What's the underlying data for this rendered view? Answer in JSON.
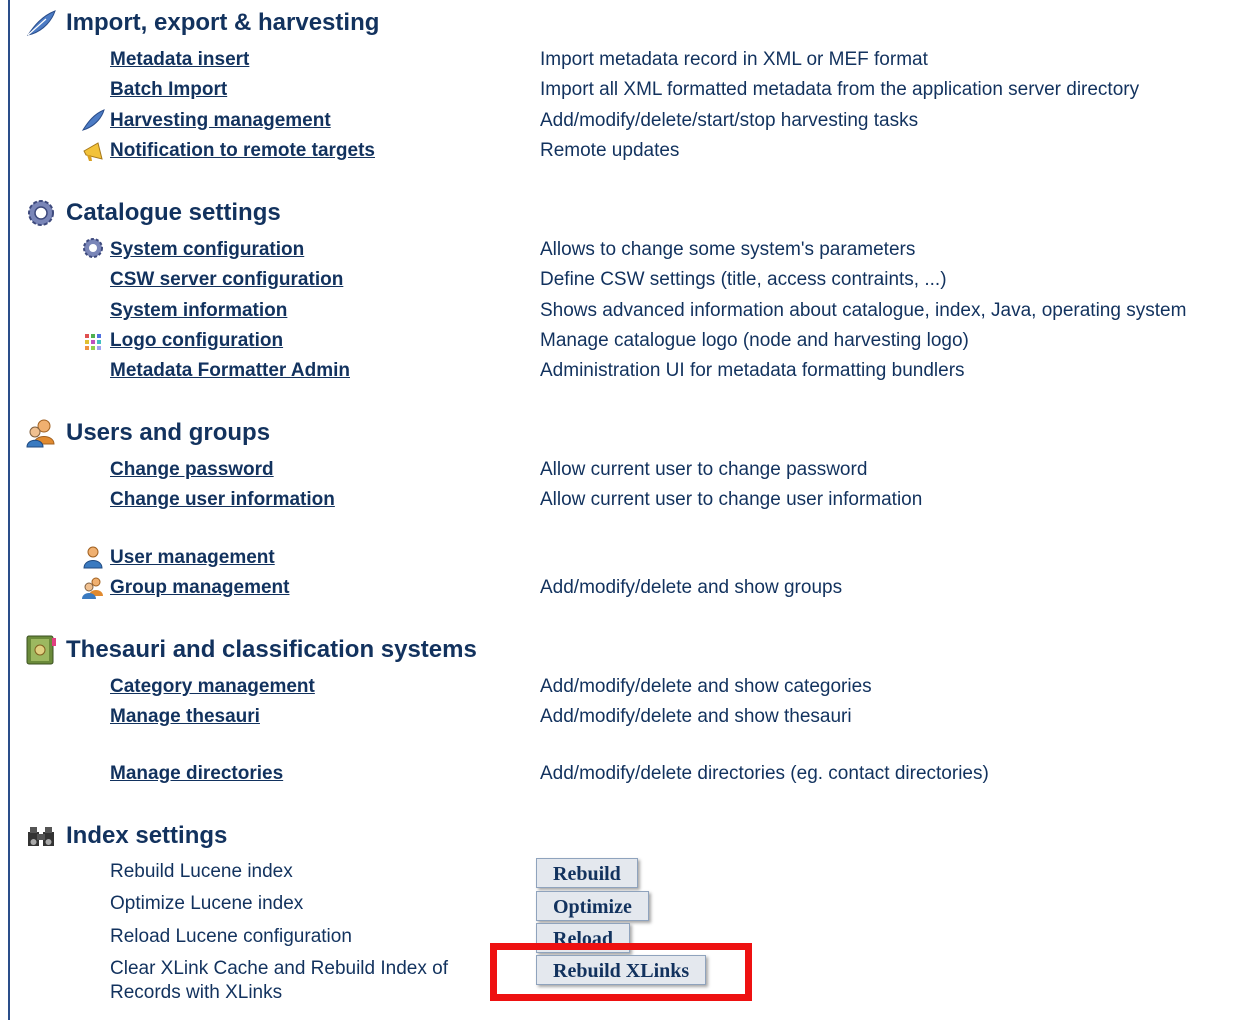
{
  "sections": {
    "import": {
      "title": "Import, export & harvesting",
      "icon": "feather-icon",
      "items": [
        {
          "label": "Metadata insert",
          "desc": "Import metadata record in XML or MEF format"
        },
        {
          "label": "Batch Import",
          "desc": "Import all XML formatted metadata from the application server directory"
        },
        {
          "label": "Harvesting management",
          "desc": "Add/modify/delete/start/stop harvesting tasks",
          "icon": "feather-icon"
        },
        {
          "label": "Notification to remote targets",
          "desc": "Remote updates",
          "icon": "megaphone-icon"
        }
      ]
    },
    "catalogue": {
      "title": "Catalogue settings",
      "icon": "gear-icon",
      "items": [
        {
          "label": "System configuration",
          "desc": "Allows to change some system's parameters",
          "icon": "gear-icon"
        },
        {
          "label": "CSW server configuration",
          "desc": "Define CSW settings (title, access contraints, ...)"
        },
        {
          "label": "System information",
          "desc": "Shows advanced information about catalogue, index, Java, operating system"
        },
        {
          "label": "Logo configuration",
          "desc": "Manage catalogue logo (node and harvesting logo)",
          "icon": "color-grid-icon"
        },
        {
          "label": "Metadata Formatter Admin",
          "desc": "Administration UI for metadata formatting bundlers"
        }
      ]
    },
    "users": {
      "title": "Users and groups",
      "icon": "users-icon",
      "items": [
        {
          "label": "Change password",
          "desc": "Allow current user to change password"
        },
        {
          "label": "Change user information",
          "desc": "Allow current user to change user information"
        },
        {
          "label": "User management",
          "desc": "",
          "icon": "user-icon"
        },
        {
          "label": "Group management",
          "desc": "Add/modify/delete and show groups",
          "icon": "group-icon"
        }
      ]
    },
    "thesauri": {
      "title": "Thesauri and classification systems",
      "icon": "book-icon",
      "items": [
        {
          "label": "Category management",
          "desc": "Add/modify/delete and show categories"
        },
        {
          "label": "Manage thesauri",
          "desc": "Add/modify/delete and show thesauri"
        },
        {
          "label": "Manage directories",
          "desc": "Add/modify/delete directories (eg. contact directories)"
        }
      ]
    },
    "index": {
      "title": "Index settings",
      "icon": "binoculars-icon",
      "items": [
        {
          "label": "Rebuild Lucene index",
          "button": "Rebuild"
        },
        {
          "label": "Optimize Lucene index",
          "button": "Optimize"
        },
        {
          "label": "Reload Lucene configuration",
          "button": "Reload"
        },
        {
          "label_line1": "Clear XLink Cache and Rebuild Index of",
          "label_line2": "Records with XLinks",
          "button": "Rebuild XLinks"
        }
      ]
    }
  },
  "colors": {
    "text": "#12325e",
    "highlight": "#ee1111",
    "button_bg": "#e4e8ee"
  }
}
